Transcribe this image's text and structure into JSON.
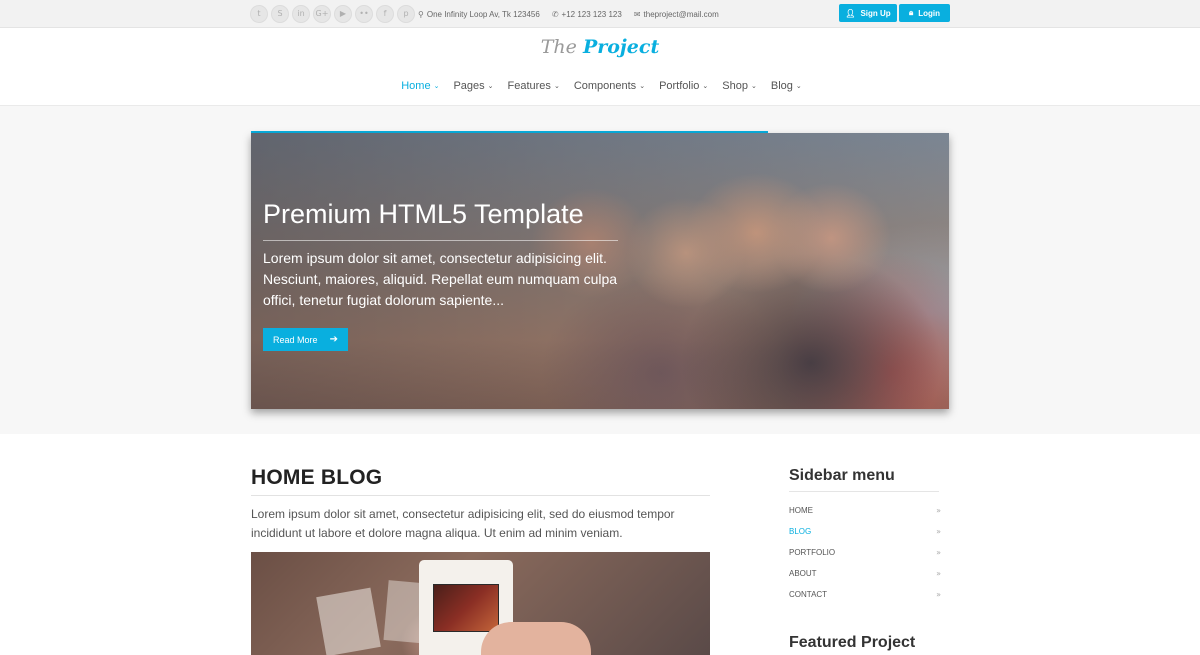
{
  "topbar": {
    "social_icons": [
      {
        "name": "twitter-icon",
        "glyph": "t"
      },
      {
        "name": "skype-icon",
        "glyph": "S"
      },
      {
        "name": "linkedin-icon",
        "glyph": "in"
      },
      {
        "name": "googleplus-icon",
        "glyph": "G+"
      },
      {
        "name": "youtube-icon",
        "glyph": "▶"
      },
      {
        "name": "flickr-icon",
        "glyph": "••"
      },
      {
        "name": "facebook-icon",
        "glyph": "f"
      },
      {
        "name": "pinterest-icon",
        "glyph": "p"
      }
    ],
    "address": "One Infinity Loop Av, Tk 123456",
    "phone": "+12 123 123 123",
    "email": "theproject@mail.com",
    "signup_label": "Sign Up",
    "login_label": "Login"
  },
  "header": {
    "logo_prefix": "The",
    "logo_main": "Project",
    "nav": [
      {
        "label": "Home",
        "active": true
      },
      {
        "label": "Pages",
        "active": false
      },
      {
        "label": "Features",
        "active": false
      },
      {
        "label": "Components",
        "active": false
      },
      {
        "label": "Portfolio",
        "active": false
      },
      {
        "label": "Shop",
        "active": false
      },
      {
        "label": "Blog",
        "active": false
      }
    ]
  },
  "hero": {
    "title": "Premium HTML5 Template",
    "text": "Lorem ipsum dolor sit amet, consectetur adipisicing elit. Nesciunt, maiores, aliquid. Repellat eum numquam culpa offici, tenetur fugiat dolorum sapiente...",
    "button_label": "Read More",
    "slider_progress": 0.74
  },
  "blog": {
    "title": "HOME BLOG",
    "intro": "Lorem ipsum dolor sit amet, consectetur adipisicing elit, sed do eiusmod tempor incididunt ut labore et dolore magna aliqua. Ut enim ad minim veniam."
  },
  "sidebar": {
    "title": "Sidebar menu",
    "items": [
      {
        "label": "HOME",
        "active": false
      },
      {
        "label": "BLOG",
        "active": true
      },
      {
        "label": "PORTFOLIO",
        "active": false
      },
      {
        "label": "ABOUT",
        "active": false
      },
      {
        "label": "CONTACT",
        "active": false
      }
    ],
    "featured_title": "Featured Project"
  },
  "colors": {
    "accent": "#09afdf",
    "topbar_bg": "#f2f2f2",
    "hero_band_bg": "#f7f7f7"
  }
}
